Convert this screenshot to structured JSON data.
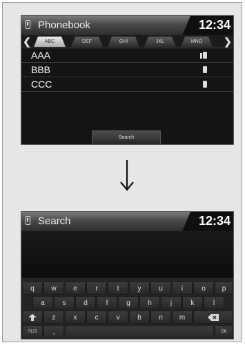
{
  "phonebook_screen": {
    "title": "Phonebook",
    "clock": "12:34",
    "tabs": [
      "ABC",
      "DEF",
      "GHI",
      "JKL",
      "MNO"
    ],
    "active_tab": "ABC",
    "contacts": [
      {
        "name": "AAA",
        "icon": "multiple-phones-icon"
      },
      {
        "name": "BBB",
        "icon": "phone-icon"
      },
      {
        "name": "CCC",
        "icon": "phone-icon"
      }
    ],
    "search_button": "Search"
  },
  "transition_icon": "down-arrow-icon",
  "search_screen": {
    "title": "Search",
    "clock": "12:34",
    "keyboard": {
      "row1": [
        "q",
        "w",
        "e",
        "r",
        "t",
        "y",
        "u",
        "i",
        "o",
        "p"
      ],
      "row2": [
        "a",
        "s",
        "d",
        "f",
        "g",
        "h",
        "j",
        "k",
        "l"
      ],
      "row3": [
        "z",
        "x",
        "c",
        "v",
        "b",
        "n",
        "m"
      ],
      "shift_icon": "shift-arrow-icon",
      "backspace_icon": "backspace-icon",
      "numbers_key": "?123",
      "comma_key": ",",
      "ok_key": "OK"
    }
  },
  "colors": {
    "screen_bg": "#141414",
    "frame_bg": "#e6e6e6",
    "active_tab": "#d9d9d9"
  }
}
